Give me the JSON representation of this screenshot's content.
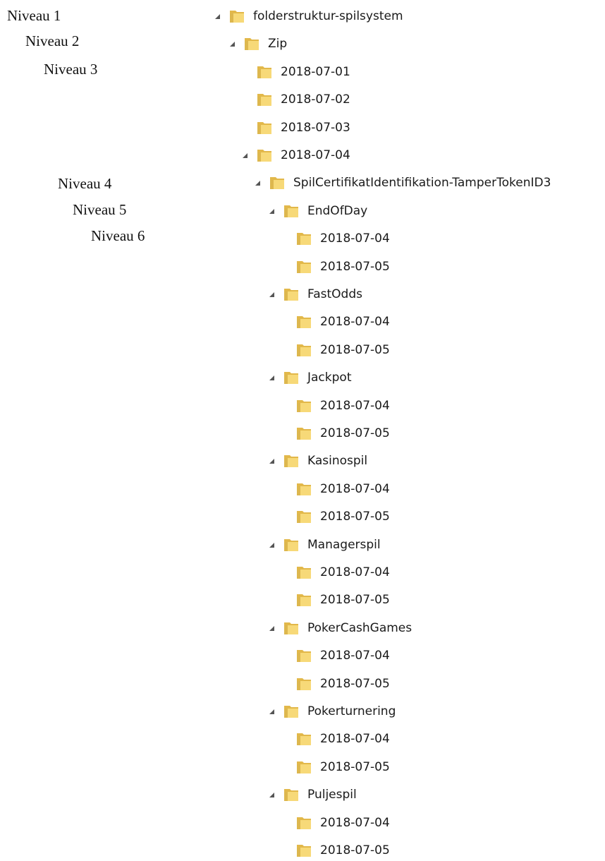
{
  "level_labels": [
    "Niveau 1",
    "Niveau 2",
    "Niveau 3",
    "Niveau 4",
    "Niveau 5",
    "Niveau 6"
  ],
  "tree": {
    "root": "folderstruktur-spilsystem",
    "level2": "Zip",
    "dates": [
      "2018-07-01",
      "2018-07-02",
      "2018-07-03",
      "2018-07-04"
    ],
    "certificate": "SpilCertifikatIdentifikation-TamperTokenID3",
    "categories": [
      {
        "name": "EndOfDay",
        "dates": [
          "2018-07-04",
          "2018-07-05"
        ]
      },
      {
        "name": "FastOdds",
        "dates": [
          "2018-07-04",
          "2018-07-05"
        ]
      },
      {
        "name": "Jackpot",
        "dates": [
          "2018-07-04",
          "2018-07-05"
        ]
      },
      {
        "name": "Kasinospil",
        "dates": [
          "2018-07-04",
          "2018-07-05"
        ]
      },
      {
        "name": "Managerspil",
        "dates": [
          "2018-07-04",
          "2018-07-05"
        ]
      },
      {
        "name": "PokerCashGames",
        "dates": [
          "2018-07-04",
          "2018-07-05"
        ]
      },
      {
        "name": "Pokerturnering",
        "dates": [
          "2018-07-04",
          "2018-07-05"
        ]
      },
      {
        "name": "Puljespil",
        "dates": [
          "2018-07-04",
          "2018-07-05"
        ]
      }
    ]
  },
  "colors": {
    "folder_back": "#e2b84a",
    "folder_front": "#f7d978",
    "folder_shade": "#c99a2c",
    "arrow": "#555555"
  },
  "icons": {
    "folder": "folder-icon",
    "expanded_arrow": "expanded-arrow-icon"
  }
}
